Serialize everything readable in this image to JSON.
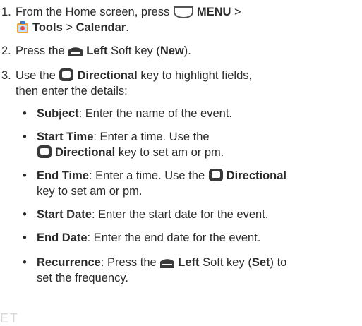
{
  "steps": [
    {
      "number": "1.",
      "parts": {
        "a": "From the Home screen, press",
        "menu": "MENU",
        "gt1": ">",
        "tools": "Tools",
        "gt2": ">",
        "calendar": "Calendar",
        "end": "."
      }
    },
    {
      "number": "2.",
      "parts": {
        "a": "Press the",
        "left": "Left",
        "b": "Soft key (",
        "new": "New",
        "c": ")."
      }
    },
    {
      "number": "3.",
      "parts": {
        "a": "Use the",
        "directional": "Directional",
        "b": "key to highlight fields,",
        "c": "then enter the details:"
      }
    }
  ],
  "bullets": [
    {
      "dot": "•",
      "term": "Subject",
      "text": ": Enter the name of the event."
    },
    {
      "dot": "•",
      "term": "Start Time",
      "text1": ": Enter a time. Use the",
      "directional": "Directional",
      "text2": "key to set am or pm."
    },
    {
      "dot": "•",
      "term": "End Time",
      "text1": ": Enter a time. Use the",
      "directional": "Directional",
      "text2": "key to set am or pm."
    },
    {
      "dot": "•",
      "term": "Start Date",
      "text": ": Enter the start date for the event."
    },
    {
      "dot": "•",
      "term": "End Date",
      "text": ": Enter the end date for the event."
    },
    {
      "dot": "•",
      "term": "Recurrence",
      "text1": ": Press the",
      "left": "Left",
      "text2": "Soft key (",
      "set": "Set",
      "text3": ") to",
      "text4": "set the frequency."
    }
  ],
  "icons": {
    "menu_key": "menu-key-icon",
    "tools": "tools-icon",
    "left_softkey": "left-softkey-icon",
    "directional_key": "directional-key-icon"
  },
  "watermark": "ET"
}
